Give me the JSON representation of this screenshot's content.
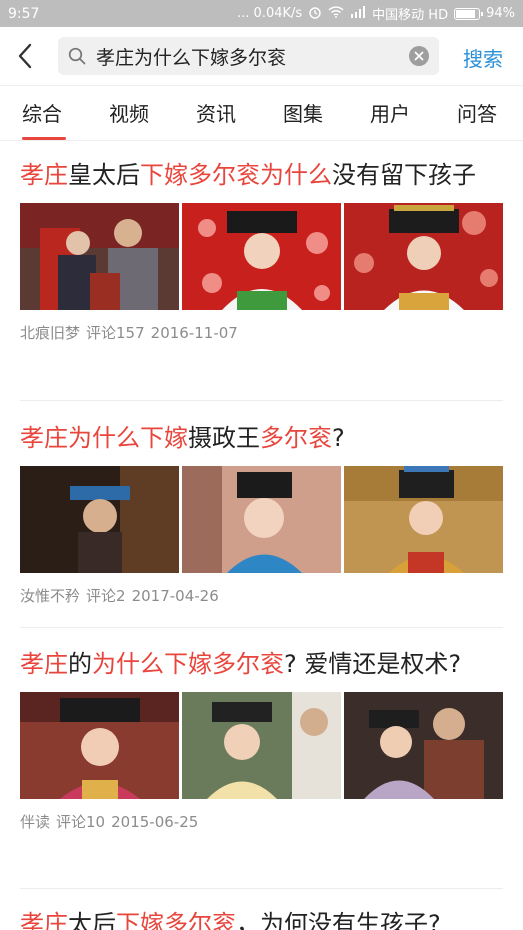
{
  "status_bar": {
    "time": "9:57",
    "network_speed": "... 0.04K/s",
    "carrier": "中国移动 HD",
    "battery": "94%",
    "battery_level": 0.94
  },
  "search": {
    "query": "孝庄为什么下嫁多尔衮",
    "search_label": "搜索"
  },
  "tabs": [
    {
      "label": "综合",
      "active": true
    },
    {
      "label": "视频",
      "active": false
    },
    {
      "label": "资讯",
      "active": false
    },
    {
      "label": "图集",
      "active": false
    },
    {
      "label": "用户",
      "active": false
    },
    {
      "label": "问答",
      "active": false
    }
  ],
  "colors": {
    "highlight": "#e8453c",
    "accent_blue": "#2a90d8",
    "meta_text": "#8c8c8c"
  },
  "results": [
    {
      "title_parts": [
        {
          "text": "孝庄",
          "hl": true
        },
        {
          "text": "皇太后",
          "hl": false
        },
        {
          "text": "下嫁多尔衮为什么",
          "hl": true
        },
        {
          "text": "没有留下孩子",
          "hl": false
        }
      ],
      "author": "北痕旧梦",
      "comments": "评论157",
      "date": "2016-11-07"
    },
    {
      "title_parts": [
        {
          "text": "孝庄为什么下嫁",
          "hl": true
        },
        {
          "text": "摄政王",
          "hl": false
        },
        {
          "text": "多尔衮",
          "hl": true
        },
        {
          "text": "?",
          "hl": false
        }
      ],
      "author": "汝惟不矜",
      "comments": "评论2",
      "date": "2017-04-26"
    },
    {
      "title_parts": [
        {
          "text": "孝庄",
          "hl": true
        },
        {
          "text": "的",
          "hl": false
        },
        {
          "text": "为什么下嫁多尔衮",
          "hl": true
        },
        {
          "text": "? 爱情还是权术?",
          "hl": false
        }
      ],
      "author": "伴读",
      "comments": "评论10",
      "date": "2015-06-25"
    },
    {
      "title_parts": [
        {
          "text": "孝庄",
          "hl": true
        },
        {
          "text": "太后",
          "hl": false
        },
        {
          "text": "下嫁多尔衮",
          "hl": true
        },
        {
          "text": "，为何没有生孩子?",
          "hl": false
        }
      ]
    }
  ]
}
